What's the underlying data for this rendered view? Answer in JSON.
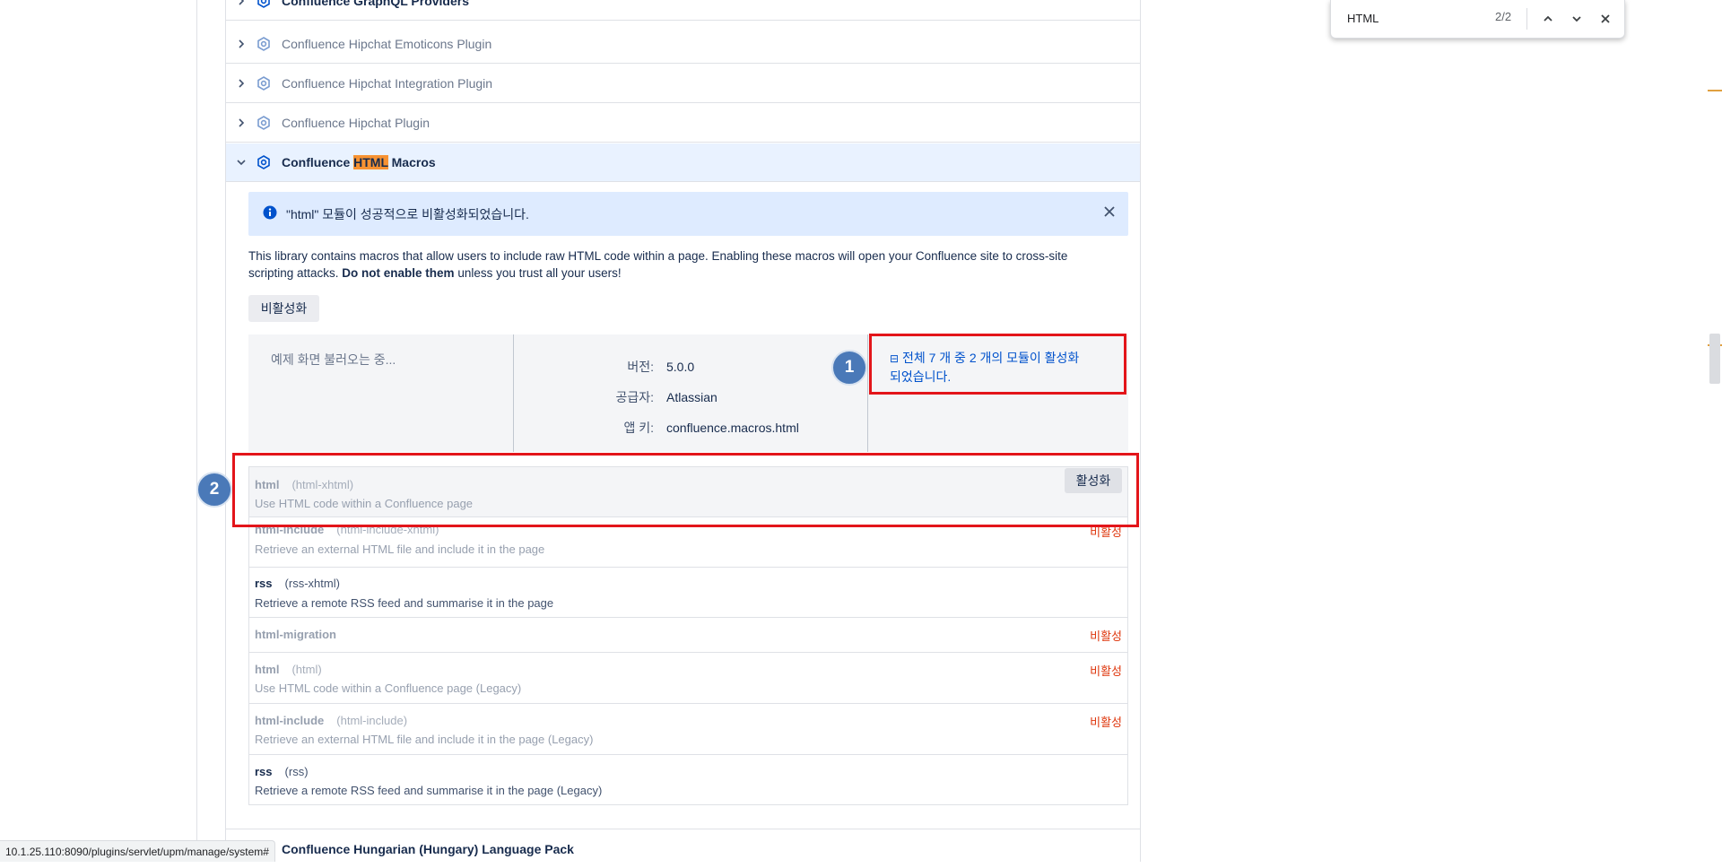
{
  "plugins": [
    {
      "name": "Confluence GraphQL Providers"
    },
    {
      "name": "Confluence Hipchat Emoticons Plugin"
    },
    {
      "name": "Confluence Hipchat Integration Plugin"
    },
    {
      "name": "Confluence Hipchat Plugin"
    }
  ],
  "expanded_plugin": {
    "name_before": "Confluence ",
    "name_highlight": "HTML",
    "name_after": " Macros",
    "message": "\"html\" 모듈이 성공적으로 비활성화되었습니다.",
    "description_main": "This library contains macros that allow users to include raw HTML code within a page. Enabling these macros will open your Confluence site to cross-site scripting attacks. ",
    "description_bold": "Do not enable them",
    "description_tail": " unless you trust all your users!",
    "disable_button": "비활성화",
    "loading_text": "예제 화면 불러오는 중...",
    "version_label": "버전:",
    "version_value": "5.0.0",
    "vendor_label": "공급자:",
    "vendor_value": "Atlassian",
    "appkey_label": "앱 키:",
    "appkey_value": "confluence.macros.html",
    "modules_summary_icon": "⊟",
    "modules_summary": "전체 7 개 중 2 개의 모듈이 활성화되었습니다.",
    "modules": [
      {
        "name": "html",
        "key": "(html-xhtml)",
        "desc": "Use HTML code within a Confluence page",
        "status": "",
        "action": "활성화"
      },
      {
        "name": "html-include",
        "key": "(html-include-xhtml)",
        "desc": "Retrieve an external HTML file and include it in the page",
        "status": "비활성"
      },
      {
        "name": "rss",
        "key": "(rss-xhtml)",
        "desc": "Retrieve a remote RSS feed and summarise it in the page",
        "status": ""
      },
      {
        "name": "html-migration",
        "key": "",
        "desc": "",
        "status": "비활성"
      },
      {
        "name": "html",
        "key": "(html)",
        "desc": "Use HTML code within a Confluence page (Legacy)",
        "status": "비활성"
      },
      {
        "name": "html-include",
        "key": "(html-include)",
        "desc": "Retrieve an external HTML file and include it in the page (Legacy)",
        "status": "비활성"
      },
      {
        "name": "rss",
        "key": "(rss)",
        "desc": "Retrieve a remote RSS feed and summarise it in the page (Legacy)",
        "status": ""
      }
    ]
  },
  "next_plugin": {
    "name": "Confluence Hungarian (Hungary) Language Pack"
  },
  "annotations": [
    "1",
    "2"
  ],
  "status_url": "10.1.25.110:8090/plugins/servlet/upm/manage/system#",
  "find_bar": {
    "query": "HTML",
    "count": "2/2"
  },
  "colors": {
    "accent": "#0052cc",
    "annotation_red": "#e3151a",
    "highlight": "#f79232",
    "disabled_red": "#de350b"
  }
}
